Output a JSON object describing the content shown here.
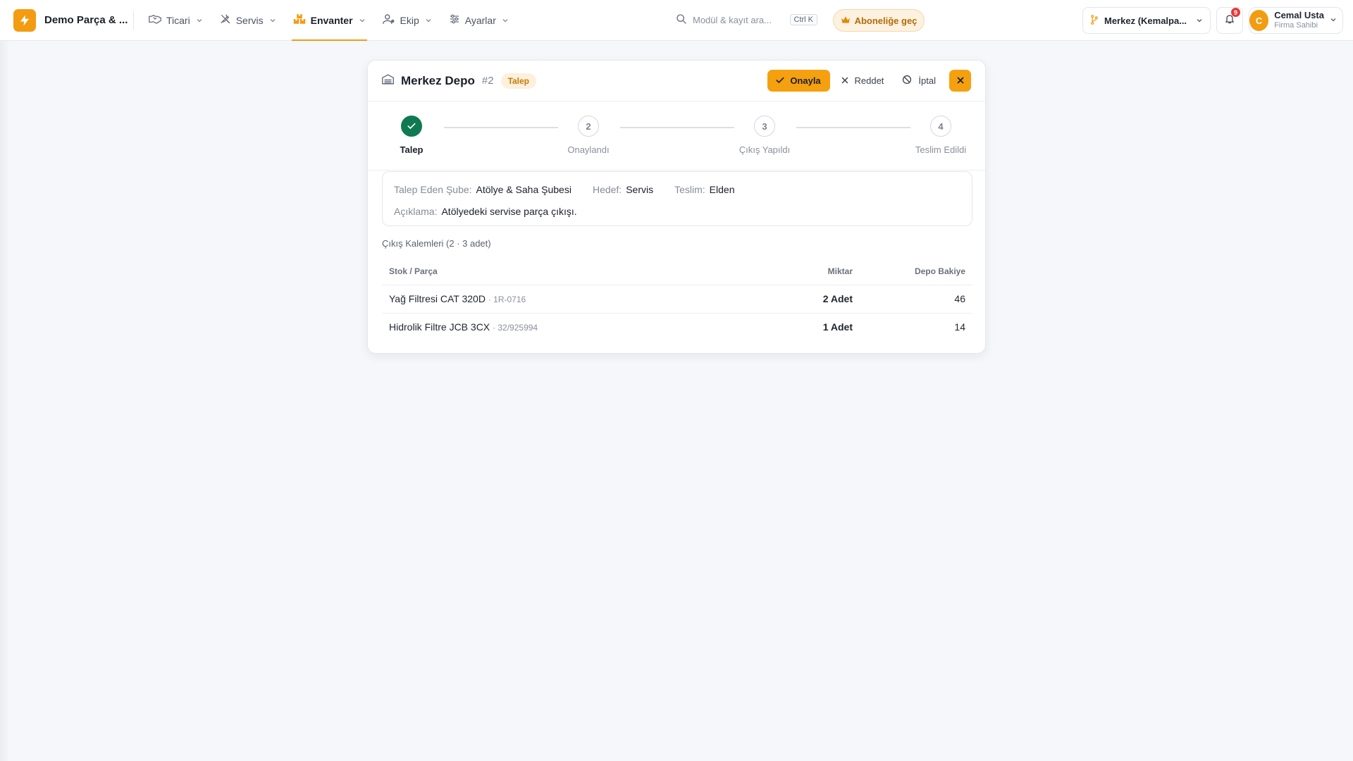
{
  "brand": {
    "name": "Demo Parça & ..."
  },
  "nav": [
    {
      "label": "Ticari",
      "icon": "handshake-icon"
    },
    {
      "label": "Servis",
      "icon": "tools-icon"
    },
    {
      "label": "Envanter",
      "icon": "boxes-icon",
      "active": true
    },
    {
      "label": "Ekip",
      "icon": "users-icon"
    },
    {
      "label": "Ayarlar",
      "icon": "sliders-icon"
    }
  ],
  "search": {
    "placeholder": "Modül & kayıt ara...",
    "shortcut": "Ctrl K"
  },
  "upgrade": {
    "label": "Aboneliğe geç"
  },
  "branch": {
    "label": "Merkez (Kemalpa..."
  },
  "notifications": {
    "count": "9"
  },
  "user": {
    "initial": "C",
    "name": "Cemal Usta",
    "role": "Firma Sahibi"
  },
  "panel": {
    "title": "Merkez Depo",
    "number": "#2",
    "status_badge": "Talep",
    "actions": {
      "approve": "Onayla",
      "reject": "Reddet",
      "cancel": "İptal"
    },
    "steps": [
      {
        "label": "Talep",
        "number": "1",
        "done": true
      },
      {
        "label": "Onaylandı",
        "number": "2",
        "done": false
      },
      {
        "label": "Çıkış Yapıldı",
        "number": "3",
        "done": false
      },
      {
        "label": "Teslim Edildi",
        "number": "4",
        "done": false
      }
    ],
    "info": {
      "branch_label": "Talep Eden Şube:",
      "branch_value": "Atölye & Saha Şubesi",
      "target_label": "Hedef:",
      "target_value": "Servis",
      "delivery_label": "Teslim:",
      "delivery_value": "Elden",
      "note_label": "Açıklama:",
      "note_value": "Atölyedeki servise parça çıkışı."
    },
    "items_title": "Çıkış Kalemleri (2 · 3 adet)",
    "table": {
      "headers": {
        "part": "Stok / Parça",
        "qty": "Miktar",
        "balance": "Depo Bakiye"
      },
      "rows": [
        {
          "name": "Yağ Filtresi CAT 320D",
          "code": "· 1R-0716",
          "qty": "2 Adet",
          "balance": "46"
        },
        {
          "name": "Hidrolik Filtre JCB 3CX",
          "code": "· 32/925994",
          "qty": "1 Adet",
          "balance": "14"
        }
      ]
    }
  },
  "colors": {
    "accent": "#f5a00f",
    "success": "#0f7a52",
    "badge_text": "#c97a0a"
  }
}
